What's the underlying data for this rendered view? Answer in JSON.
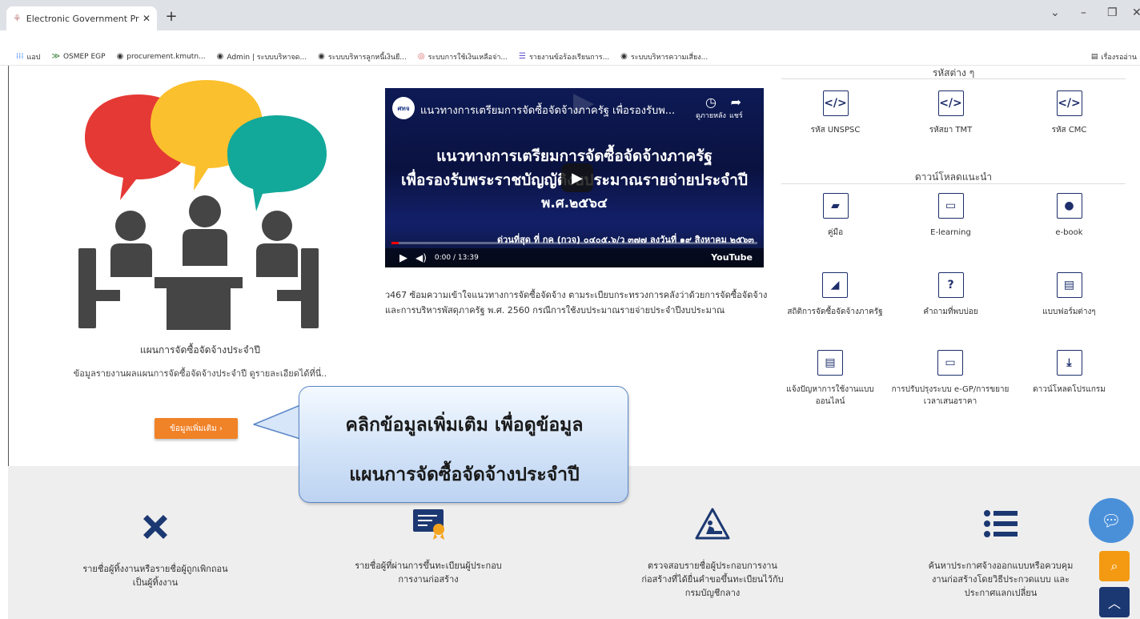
{
  "browser": {
    "tab_title": "Electronic Government Procurem",
    "new_tab": "+",
    "bookmarks": [
      {
        "icon": "apps-icon",
        "label": "แอป"
      },
      {
        "icon": "chevron-double-icon",
        "label": "OSMEP EGP"
      },
      {
        "icon": "globe-icon",
        "label": "procurement.kmutn..."
      },
      {
        "icon": "globe-icon",
        "label": "Admin | ระบบบริหาจด..."
      },
      {
        "icon": "globe-icon",
        "label": "ระบบบริหารลูกหนี้เงินยื..."
      },
      {
        "icon": "seal-icon",
        "label": "ระบบการใช้เงินเหลือจ่า..."
      },
      {
        "icon": "list-icon",
        "label": "รายงานข้อร้องเรียนการ..."
      },
      {
        "icon": "globe-icon",
        "label": "ระบบบริหารความเสี่ยง..."
      }
    ],
    "reading_list": "เรื่องรออ่าน"
  },
  "left": {
    "title": "แผนการจัดซื้อจัดจ้างประจำปี",
    "desc": "ข้อมูลรายงานผลแผนการจัดซื้อจัดจ้างประจำปี ดูรายละเอียดได้ที่นี่..",
    "more_btn": "ข้อมูลเพิ่มเติม ›"
  },
  "video": {
    "channel": "ศทจ",
    "title": "แนวทางการเตรียมการจัดซื้อจัดจ้างภาครัฐ เพื่อรองรับพ...",
    "watch_later": "ดูภายหลัง",
    "share": "แชร์",
    "line1": "แนวทางการเตรียมการจัดซื้อจัดจ้างภาครัฐ",
    "line2": "เพื่อรองรับพระราชบัญญัติงบประมาณรายจ่ายประจำปี",
    "line3": "พ.ศ.๒๕๖๔",
    "ticker": "ด่วนที่สุด ที่ กค (กวจ) ๐๔๐๕.๖/ว ๓๗๗ ลงวันที่ ๑๙ สิงหาคม ๒๕๖๓",
    "time": "0:00 / 13:39",
    "brand": "YouTube",
    "progress": 0.02,
    "desc": "ว467 ซ้อมความเข้าใจแนวทางการจัดซื้อจัดจ้าง ตามระเบียบกระทรวงการคลังว่าด้วยการจัดซื้อจัดจ้างและการบริหารพัสดุภาครัฐ พ.ศ. 2560 กรณีการใช้งบประมาณรายจ่ายประจำปีงบประมาณ"
  },
  "right": {
    "codes_heading": "รหัสต่าง ๆ",
    "codes": [
      {
        "label": "รหัส UNSPSC",
        "icon": "code-icon"
      },
      {
        "label": "รหัสยา TMT",
        "icon": "code-icon"
      },
      {
        "label": "รหัส CMC",
        "icon": "code-icon"
      }
    ],
    "downloads_heading": "ดาวน์โหลดแนะนำ",
    "downloads": [
      {
        "label": "คู่มือ",
        "icon": "book-icon"
      },
      {
        "label": "E-learning",
        "icon": "monitor-icon"
      },
      {
        "label": "e-book",
        "icon": "tablet-icon"
      },
      {
        "label": "สถิติการจัดซื้อจัดจ้างภาครัฐ",
        "icon": "chart-icon"
      },
      {
        "label": "คำถามที่พบบ่อย",
        "icon": "question-icon"
      },
      {
        "label": "แบบฟอร์มต่างๆ",
        "icon": "document-icon"
      },
      {
        "label": "แจ้งปัญหาการใช้งานแบบออนไลน์",
        "icon": "document-icon"
      },
      {
        "label": "การปรับปรุงระบบ e-GP/การขยายเวลาเสนอราคา",
        "icon": "monitor-icon"
      },
      {
        "label": "ดาวน์โหลดโปรแกรม",
        "icon": "download-icon"
      }
    ]
  },
  "callout": {
    "line1": "คลิกข้อมูลเพิ่มเติม เพื่อดูข้อมูล",
    "line2": "แผนการจัดซื้อจัดจ้างประจำปี"
  },
  "bottom": [
    {
      "icon": "x-icon",
      "l1": "รายชื่อผู้ทิ้งงานหรือรายชื่อผู้ถูกเพิกถอน",
      "l2": "เป็นผู้ทิ้งงาน",
      "l3": ""
    },
    {
      "icon": "certificate-icon",
      "l1": "รายชื่อผู้ที่ผ่านการขึ้นทะเบียนผู้ประกอบ",
      "l2": "การงานก่อสร้าง",
      "l3": ""
    },
    {
      "icon": "construction-icon",
      "l1": "ตรวจสอบรายชื่อผู้ประกอบการงาน",
      "l2": "ก่อสร้างที่ได้ยื่นคำขอขึ้นทะเบียนไว้กับ",
      "l3": "กรมบัญชีกลาง"
    },
    {
      "icon": "list-icon",
      "l1": "ค้นหาประกาศจ้างออกแบบหรือควบคุม",
      "l2": "งานก่อสร้างโดยวิธีประกวดแบบ และ",
      "l3": "ประกาศแลกเปลี่ยน"
    }
  ],
  "colors": {
    "accent_orange": "#f08228",
    "navy": "#1d2e6b",
    "chat_blue": "#4a90d9",
    "search_orange": "#f39a12"
  }
}
